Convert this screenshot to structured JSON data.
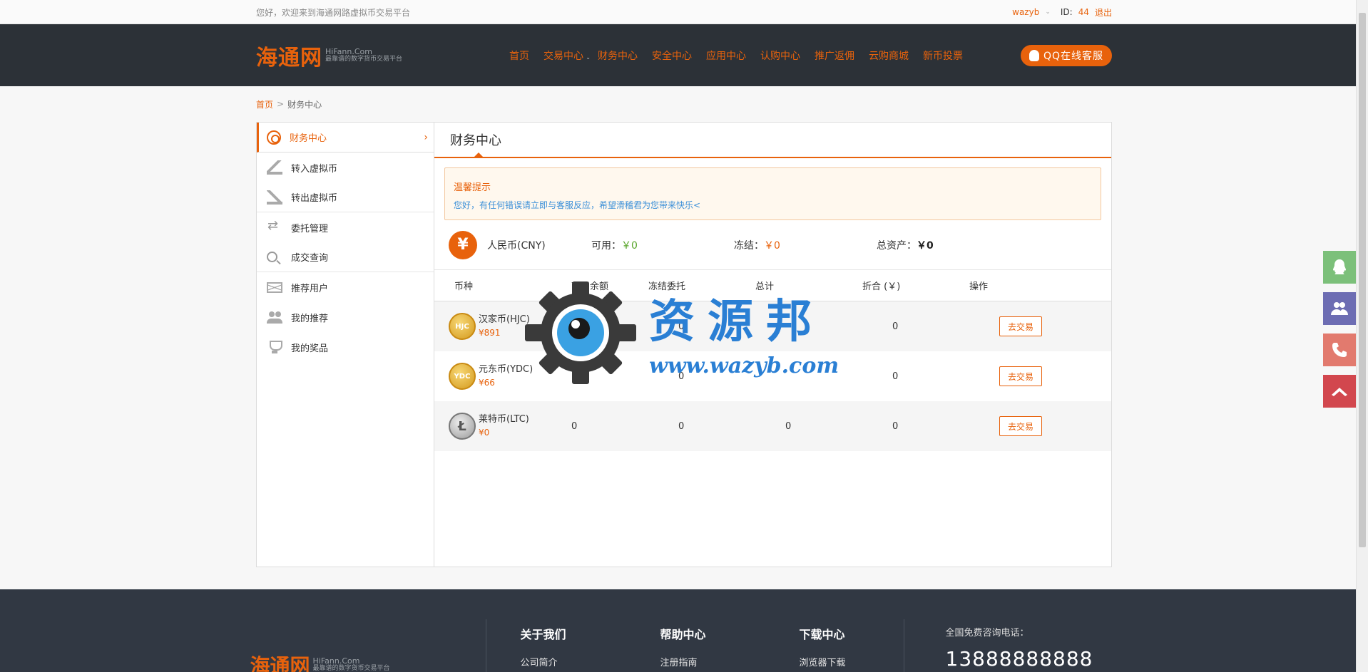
{
  "topbar": {
    "welcome": "您好，欢迎来到海通网路虚拟币交易平台",
    "username": "wazyb",
    "id_label": "ID:",
    "id_value": "44",
    "logout": "退出"
  },
  "header": {
    "logo_cn": "海通网",
    "logo_en": "HiFann.Com",
    "logo_slogan": "最靠谱的数字货币交易平台",
    "nav": [
      "首页",
      "交易中心",
      "财务中心",
      "安全中心",
      "应用中心",
      "认购中心",
      "推广返佣",
      "云购商城",
      "新币投票"
    ],
    "qq_service": "QQ在线客服"
  },
  "breadcrumb": {
    "home": "首页",
    "separator": ">",
    "current": "财务中心"
  },
  "sidebar": {
    "items": [
      {
        "label": "财务中心",
        "icon": "coins-icon",
        "active": true
      },
      {
        "label": "转入虚拟币",
        "icon": "transfer-in-icon"
      },
      {
        "label": "转出虚拟币",
        "icon": "transfer-out-icon"
      },
      {
        "label": "委托管理",
        "icon": "swap-icon"
      },
      {
        "label": "成交查询",
        "icon": "search-icon"
      },
      {
        "label": "推荐用户",
        "icon": "mail-icon"
      },
      {
        "label": "我的推荐",
        "icon": "users-icon"
      },
      {
        "label": "我的奖品",
        "icon": "trophy-icon"
      }
    ]
  },
  "content": {
    "title": "财务中心",
    "tip_title": "温馨提示",
    "tip_text": "您好，有任何错误请立即与客服反应，希望滑稽君为您带来快乐<",
    "cny": {
      "icon_glyph": "¥",
      "name": "人民币(CNY)",
      "available_label": "可用：",
      "available_value": "￥0",
      "frozen_label": "冻结：",
      "frozen_value": "￥0",
      "total_label": "总资产：",
      "total_value": "￥0"
    },
    "table": {
      "headers": [
        "币种",
        "可用余额",
        "冻结委托",
        "总计",
        "折合 (￥)",
        "操作"
      ],
      "rows": [
        {
          "name": "汉家币(HJC)",
          "price": "¥891",
          "badge": "HJC",
          "available": "",
          "frozen": "0",
          "total": "",
          "equiv": "0",
          "action": "去交易"
        },
        {
          "name": "元东币(YDC)",
          "price": "¥66",
          "badge": "YDC",
          "available": "",
          "frozen": "0",
          "total": "",
          "equiv": "0",
          "action": "去交易"
        },
        {
          "name": "莱特币(LTC)",
          "price": "¥0",
          "badge": "Ł",
          "available": "0",
          "frozen": "0",
          "total": "0",
          "equiv": "0",
          "action": "去交易"
        }
      ]
    }
  },
  "watermark": {
    "text_cn": "资源邦",
    "url": "www.wazyb.com"
  },
  "footer": {
    "logo_cn": "海通网",
    "logo_en": "HiFann.Com",
    "logo_slogan": "最靠谱的数字货币交易平台",
    "col1_title": "关于我们",
    "col1_link": "公司简介",
    "col2_title": "帮助中心",
    "col2_link": "注册指南",
    "col3_title": "下载中心",
    "col3_link": "浏览器下载",
    "phone_label": "全国免费咨询电话：",
    "phone": "13888888888"
  },
  "colors": {
    "accent": "#e8620c",
    "header_bg": "#2c3137",
    "footer_bg": "#313843",
    "link_blue": "#3b8fd8"
  }
}
